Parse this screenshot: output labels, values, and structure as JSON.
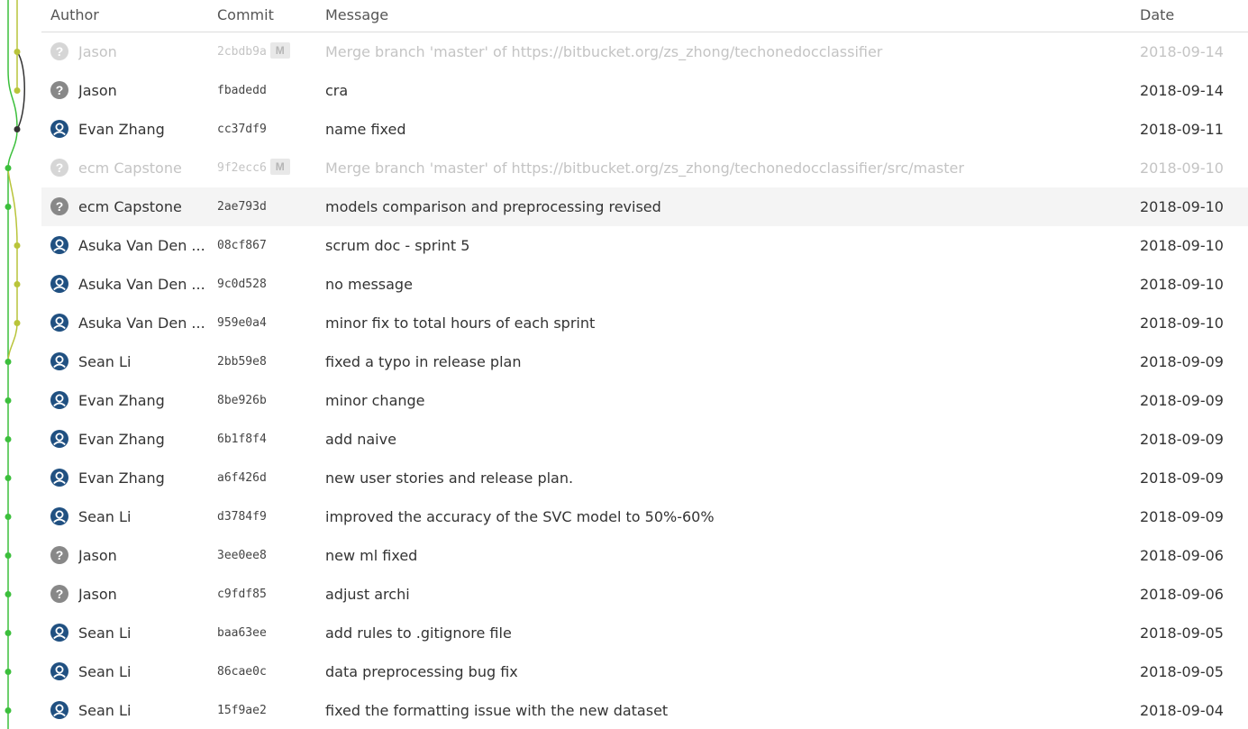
{
  "header": {
    "author": "Author",
    "commit": "Commit",
    "message": "Message",
    "date": "Date"
  },
  "colors": {
    "branch_main": "#3cbf3c",
    "branch_secondary": "#b9c43a",
    "branch_merge_source": "#333333",
    "user_avatar": "#205081",
    "unknown_avatar": "#888888",
    "selected_row": "#f4f4f4",
    "merge_text": "#c4c4c4"
  },
  "commits": [
    {
      "author": "Jason",
      "avatar": "unknown-user-icon",
      "hash": "2cbdb9a",
      "badge": "M",
      "message": "Merge branch 'master' of https://bitbucket.org/zs_zhong/techonedocclassifier",
      "date": "2018-09-14",
      "merge": true,
      "selected": false
    },
    {
      "author": "Jason",
      "avatar": "unknown-user-icon",
      "hash": "fbadedd",
      "badge": "",
      "message": "cra",
      "date": "2018-09-14",
      "merge": false,
      "selected": false
    },
    {
      "author": "Evan Zhang",
      "avatar": "user-avatar-icon",
      "hash": "cc37df9",
      "badge": "",
      "message": "name fixed",
      "date": "2018-09-11",
      "merge": false,
      "selected": false
    },
    {
      "author": "ecm Capstone",
      "avatar": "unknown-user-icon",
      "hash": "9f2ecc6",
      "badge": "M",
      "message": "Merge branch 'master' of https://bitbucket.org/zs_zhong/techonedocclassifier/src/master",
      "date": "2018-09-10",
      "merge": true,
      "selected": false
    },
    {
      "author": "ecm Capstone",
      "avatar": "unknown-user-icon",
      "hash": "2ae793d",
      "badge": "",
      "message": "models comparison and preprocessing revised",
      "date": "2018-09-10",
      "merge": false,
      "selected": true
    },
    {
      "author": "Asuka Van Den ...",
      "avatar": "user-avatar-icon",
      "hash": "08cf867",
      "badge": "",
      "message": "scrum doc - sprint 5",
      "date": "2018-09-10",
      "merge": false,
      "selected": false
    },
    {
      "author": "Asuka Van Den ...",
      "avatar": "user-avatar-icon",
      "hash": "9c0d528",
      "badge": "",
      "message": "no message",
      "date": "2018-09-10",
      "merge": false,
      "selected": false
    },
    {
      "author": "Asuka Van Den ...",
      "avatar": "user-avatar-icon",
      "hash": "959e0a4",
      "badge": "",
      "message": "minor fix to total hours of each sprint",
      "date": "2018-09-10",
      "merge": false,
      "selected": false
    },
    {
      "author": "Sean Li",
      "avatar": "user-avatar-icon",
      "hash": "2bb59e8",
      "badge": "",
      "message": "fixed a typo in release plan",
      "date": "2018-09-09",
      "merge": false,
      "selected": false
    },
    {
      "author": "Evan Zhang",
      "avatar": "user-avatar-icon",
      "hash": "8be926b",
      "badge": "",
      "message": "minor change",
      "date": "2018-09-09",
      "merge": false,
      "selected": false
    },
    {
      "author": "Evan Zhang",
      "avatar": "user-avatar-icon",
      "hash": "6b1f8f4",
      "badge": "",
      "message": "add naive",
      "date": "2018-09-09",
      "merge": false,
      "selected": false
    },
    {
      "author": "Evan Zhang",
      "avatar": "user-avatar-icon",
      "hash": "a6f426d",
      "badge": "",
      "message": "new user stories and release plan.",
      "date": "2018-09-09",
      "merge": false,
      "selected": false
    },
    {
      "author": "Sean Li",
      "avatar": "user-avatar-icon",
      "hash": "d3784f9",
      "badge": "",
      "message": "improved the accuracy of the SVC model to 50%-60%",
      "date": "2018-09-09",
      "merge": false,
      "selected": false
    },
    {
      "author": "Jason",
      "avatar": "unknown-user-icon",
      "hash": "3ee0ee8",
      "badge": "",
      "message": "new ml fixed",
      "date": "2018-09-06",
      "merge": false,
      "selected": false
    },
    {
      "author": "Jason",
      "avatar": "unknown-user-icon",
      "hash": "c9fdf85",
      "badge": "",
      "message": "adjust archi",
      "date": "2018-09-06",
      "merge": false,
      "selected": false
    },
    {
      "author": "Sean Li",
      "avatar": "user-avatar-icon",
      "hash": "baa63ee",
      "badge": "",
      "message": "add rules to .gitignore file",
      "date": "2018-09-05",
      "merge": false,
      "selected": false
    },
    {
      "author": "Sean Li",
      "avatar": "user-avatar-icon",
      "hash": "86cae0c",
      "badge": "",
      "message": "data preprocessing bug fix",
      "date": "2018-09-05",
      "merge": false,
      "selected": false
    },
    {
      "author": "Sean Li",
      "avatar": "user-avatar-icon",
      "hash": "15f9ae2",
      "badge": "",
      "message": "fixed the formatting issue with the new dataset",
      "date": "2018-09-04",
      "merge": false,
      "selected": false
    }
  ]
}
